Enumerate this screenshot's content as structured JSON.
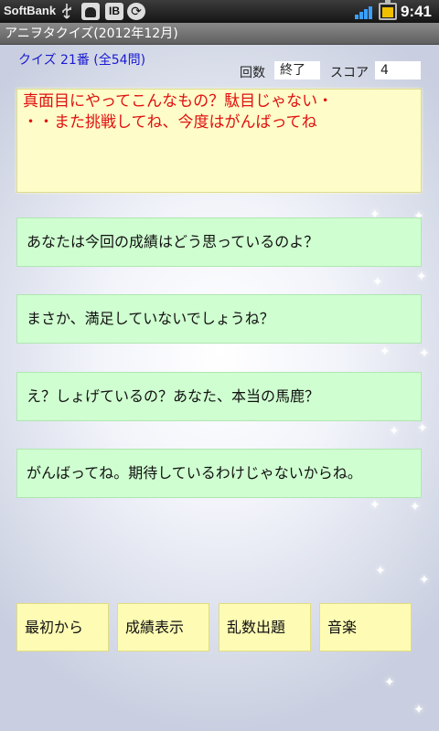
{
  "status_bar": {
    "carrier": "SoftBank",
    "ib_badge": "IB",
    "time": "9:41"
  },
  "title_bar": {
    "title": "アニヲタクイズ(2012年12月)"
  },
  "quiz": {
    "number_label": "クイズ 21番 (全54問)",
    "rounds_label": "回数",
    "rounds_value": "終了",
    "score_label": "スコア",
    "score_value": "4"
  },
  "message": {
    "line1": "真面目にやってこんなもの？駄目じゃない・",
    "line2": "・・また挑戦してね、今度はがんばってね"
  },
  "answers": [
    "あなたは今回の成績はどう思っているのよ？",
    "まさか、満足していないでしょうね？",
    "え？しょげているの？あなた、本当の馬鹿？",
    "がんばってね。期待しているわけじゃないからね。"
  ],
  "buttons": {
    "restart": "最初から",
    "show_score": "成績表示",
    "random": "乱数出題",
    "music": "音楽"
  }
}
